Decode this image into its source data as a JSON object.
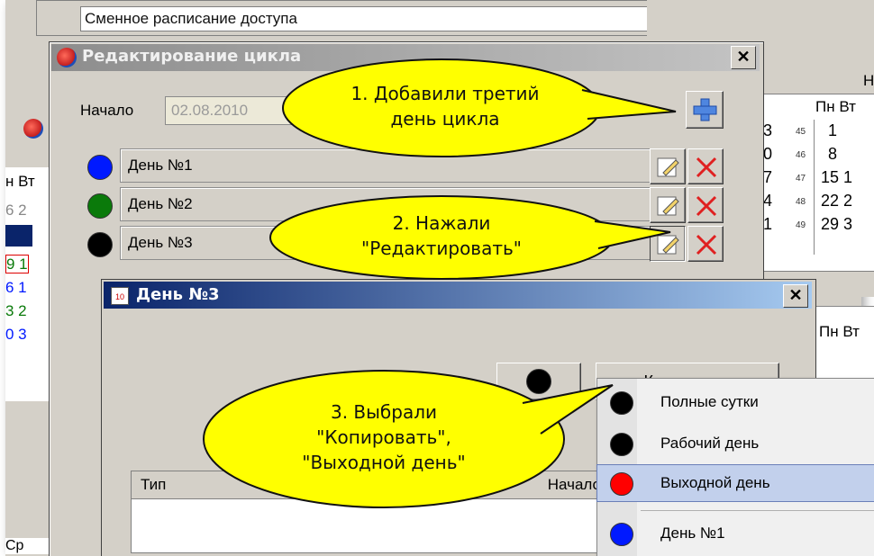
{
  "background_app": {
    "top_field_text": "Сменное расписание доступа",
    "left_fragment": {
      "header": "н Вт",
      "rows": [
        "6 2",
        "",
        "9 1",
        "6 1",
        "3 2",
        "0 3"
      ],
      "bottom_labels": [
        "Ср"
      ]
    },
    "calendar_top": {
      "header_partial": "Но",
      "weekdays": "Пн Вт",
      "col_left": [
        "3",
        "0",
        "7",
        "4",
        "1"
      ],
      "weeks": [
        "45",
        "46",
        "47",
        "48",
        "49"
      ],
      "days": [
        "1",
        "8",
        "15 1",
        "22 2",
        "29 3"
      ]
    },
    "calendar_bottom": {
      "weekdays": "Пн Вт"
    }
  },
  "cycle_dialog": {
    "title": "Редактирование цикла",
    "start_label": "Начало",
    "start_value": "02.08.2010",
    "add_icon": "add-plus-icon",
    "days": [
      {
        "label": "День №1",
        "color": "#0019ff"
      },
      {
        "label": "День №2",
        "color": "#0a7a0a"
      },
      {
        "label": "День №3",
        "color": "#000000"
      }
    ],
    "close_glyph": "✕"
  },
  "day_dialog": {
    "title": "День №3",
    "copy_label": "Копировать",
    "table_headers": [
      "Тип",
      "Начало"
    ],
    "close_glyph": "✕"
  },
  "copy_menu": {
    "items": [
      {
        "label": "Полные сутки",
        "color": "#000000",
        "selected": false
      },
      {
        "label": "Рабочий день",
        "color": "#000000",
        "selected": false
      },
      {
        "label": "Выходной день",
        "color": "#ff0000",
        "selected": true
      },
      {
        "label": "День №1",
        "color": "#0019ff",
        "selected": false
      }
    ]
  },
  "callouts": [
    {
      "line1": "1. Добавили третий",
      "line2": "день цикла"
    },
    {
      "line1": "2. Нажали",
      "line2": "\"Редактировать\""
    },
    {
      "line1": "3. Выбрали",
      "line2": "\"Копировать\",",
      "line3": "\"Выходной день\""
    }
  ],
  "colors": {
    "callout_fill": "#ffff00",
    "titlebar_active": "#0a246a",
    "titlebar_inactive": "#8d8d8d"
  }
}
